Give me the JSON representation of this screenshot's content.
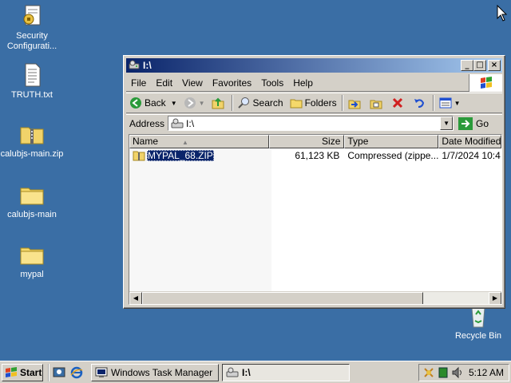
{
  "desktop": {
    "icons": [
      {
        "label": "Security Configurati...",
        "icon": "security-config-icon"
      },
      {
        "label": "TRUTH.txt",
        "icon": "text-file-icon"
      },
      {
        "label": "calubjs-main.zip",
        "icon": "zip-folder-icon"
      },
      {
        "label": "calubjs-main",
        "icon": "folder-icon"
      },
      {
        "label": "mypal",
        "icon": "folder-icon"
      },
      {
        "label": "Recycle Bin",
        "icon": "recycle-bin-icon"
      }
    ]
  },
  "window": {
    "title": "I:\\",
    "menu": [
      "File",
      "Edit",
      "View",
      "Favorites",
      "Tools",
      "Help"
    ],
    "toolbar": {
      "back": "Back",
      "search": "Search",
      "folders": "Folders"
    },
    "address": {
      "label": "Address",
      "value": "I:\\",
      "go": "Go"
    },
    "columns": [
      "Name",
      "Size",
      "Type",
      "Date Modified"
    ],
    "files": [
      {
        "name": "MYPAL_68.ZIP",
        "size": "61,123 KB",
        "type": "Compressed (zippe...",
        "date": "1/7/2024 10:4"
      }
    ]
  },
  "taskbar": {
    "start": "Start",
    "tasks": [
      {
        "label": "Windows Task Manager",
        "active": false
      },
      {
        "label": "I:\\",
        "active": true
      }
    ],
    "clock": "5:12 AM"
  },
  "colors": {
    "desktop": "#3a6ea5",
    "titlebar_start": "#0a246a",
    "titlebar_end": "#a6caf0",
    "selection": "#0a246a",
    "chrome": "#d4d0c8"
  }
}
